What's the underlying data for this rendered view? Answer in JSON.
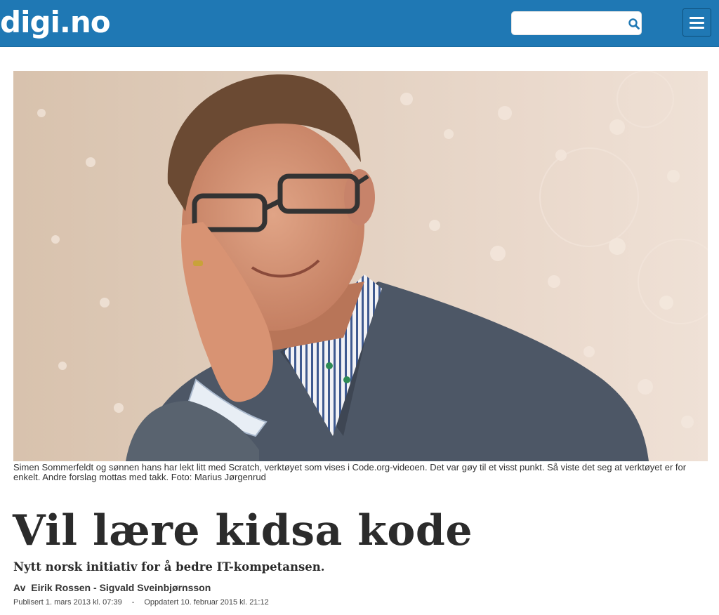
{
  "header": {
    "logo": "digi.no",
    "search": {
      "value": "",
      "placeholder": ""
    },
    "search_icon": "search-icon",
    "menu_icon": "hamburger-menu-icon",
    "colors": {
      "bar": "#1f78b4",
      "text": "#ffffff"
    }
  },
  "article": {
    "photo": {
      "alt": "Simen Sommerfeldt"
    },
    "caption": "Simen Sommerfeldt og sønnen hans har lekt litt med Scratch, verktøyet som vises i Code.org-videoen. Det var gøy til et visst punkt. Så viste det seg at verktøyet er for enkelt. Andre forslag mottas med takk. Foto: Marius Jørgenrud",
    "headline": "Vil lære kidsa kode",
    "lead": "Nytt norsk initiativ for å bedre IT-kompetansen.",
    "byline": {
      "prefix": "Av",
      "author1": "Eirik Rossen",
      "separator": "-",
      "author2": "Sigvald Sveinbjørnsson"
    },
    "published": "Publisert 1. mars 2013 kl. 07:39",
    "date_separator": "-",
    "updated": "Oppdatert 10. februar 2015 kl. 21:12"
  }
}
